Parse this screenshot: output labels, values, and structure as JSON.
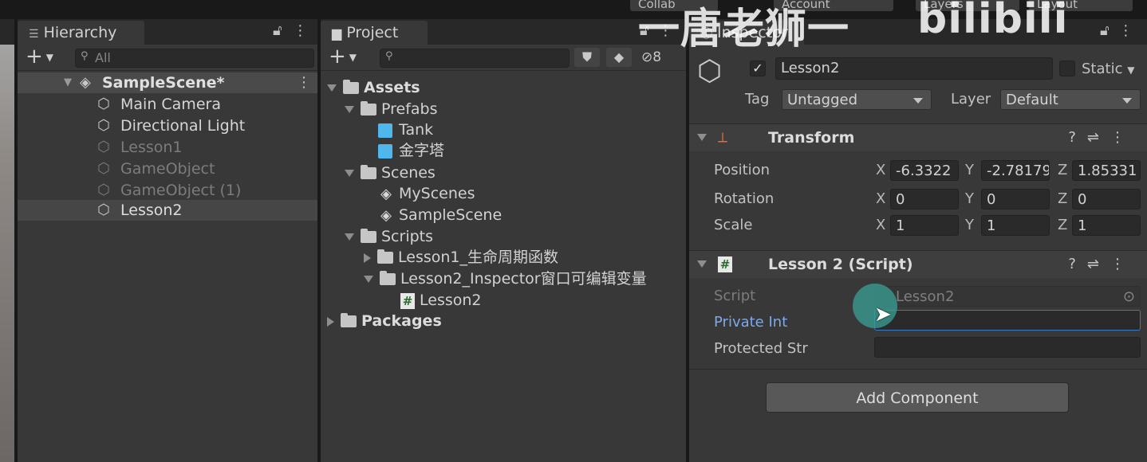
{
  "topbar": {
    "collab_label": "Collab",
    "account_label": "Account",
    "layers_label": "Layers",
    "layout_label": "Layout"
  },
  "watermark": {
    "text1": "一唐老狮一",
    "text2": "bilibili"
  },
  "hierarchy": {
    "tab_label": "Hierarchy",
    "search_placeholder": "All",
    "scene_name": "SampleScene*",
    "items": [
      {
        "label": "Main Camera",
        "active": true
      },
      {
        "label": "Directional Light",
        "active": true
      },
      {
        "label": "Lesson1",
        "active": false
      },
      {
        "label": "GameObject",
        "active": false
      },
      {
        "label": "GameObject (1)",
        "active": false
      },
      {
        "label": "Lesson2",
        "active": true,
        "selected": true
      }
    ]
  },
  "project": {
    "tab_label": "Project",
    "search_placeholder": "",
    "hidden_count": "8",
    "tree": {
      "assets": "Assets",
      "prefabs": "Prefabs",
      "tank": "Tank",
      "pyramid": "金字塔",
      "scenes": "Scenes",
      "myscenes": "MyScenes",
      "samplescene": "SampleScene",
      "scripts": "Scripts",
      "lesson1_folder": "Lesson1_生命周期函数",
      "lesson2_folder": "Lesson2_Inspector窗口可编辑变量",
      "lesson2_script": "Lesson2",
      "packages": "Packages"
    }
  },
  "inspector": {
    "tab_label": "Inspector",
    "object_name": "Lesson2",
    "object_active": true,
    "static_label": "Static",
    "tag_label": "Tag",
    "tag_value": "Untagged",
    "layer_label": "Layer",
    "layer_value": "Default",
    "transform": {
      "title": "Transform",
      "position_label": "Position",
      "rotation_label": "Rotation",
      "scale_label": "Scale",
      "axis_x": "X",
      "axis_y": "Y",
      "axis_z": "Z",
      "position": {
        "x": "-6.3322",
        "y": "-2.78179",
        "z": "1.85331"
      },
      "rotation": {
        "x": "0",
        "y": "0",
        "z": "0"
      },
      "scale": {
        "x": "1",
        "y": "1",
        "z": "1"
      }
    },
    "script_component": {
      "title": "Lesson 2 (Script)",
      "script_label": "Script",
      "script_value": "Lesson2",
      "private_int_label": "Private Int",
      "private_int_value": "",
      "protected_str_label": "Protected Str",
      "protected_str_value": ""
    },
    "add_component_label": "Add Component"
  },
  "colors": {
    "accent_selected_label": "#7ea9e5",
    "focus_border": "#3a79bb"
  }
}
